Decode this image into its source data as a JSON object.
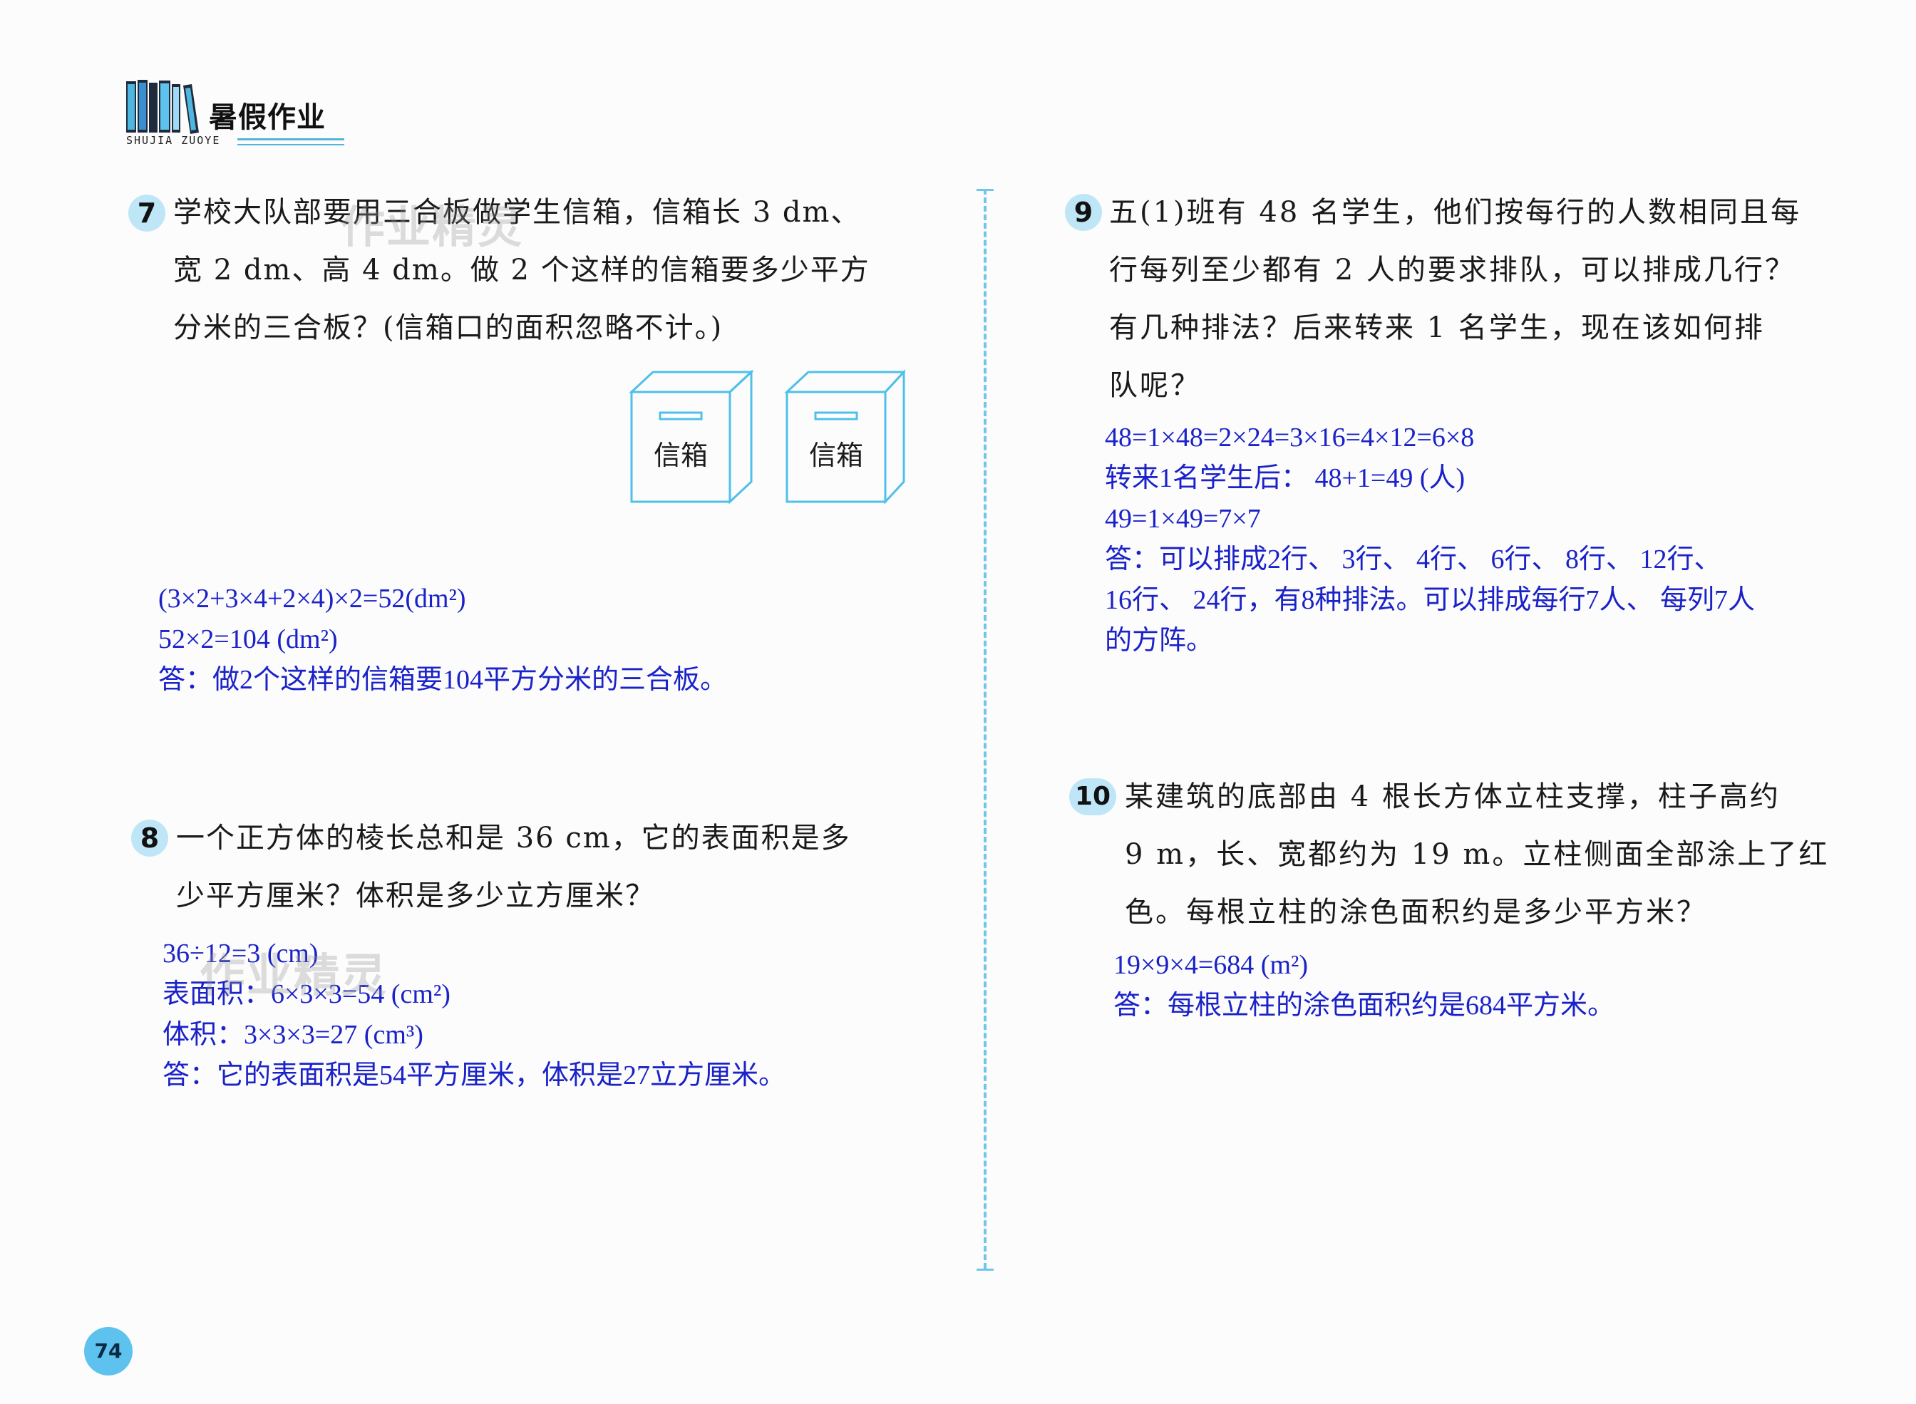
{
  "header": {
    "title": "暑假作业",
    "pinyin": "SHUJIA ZUOYE"
  },
  "questions": {
    "q7": {
      "number": "7",
      "lines": [
        "学校大队部要用三合板做学生信箱，信箱长 3 dm、",
        "宽 2 dm、高 4 dm。做 2 个这样的信箱要多少平方",
        "分米的三合板？(信箱口的面积忽略不计。)"
      ],
      "box_label": "信箱",
      "answer": [
        "(3×2+3×4+2×4)×2=52(dm²)",
        "52×2=104 (dm²)",
        "答：做2个这样的信箱要104平方分米的三合板。"
      ]
    },
    "q8": {
      "number": "8",
      "lines": [
        "一个正方体的棱长总和是 36 cm，它的表面积是多",
        "少平方厘米？体积是多少立方厘米？"
      ],
      "answer": [
        "36÷12=3 (cm)",
        "表面积：6×3×3=54 (cm²)",
        "体积：3×3×3=27 (cm³)",
        "答：它的表面积是54平方厘米，体积是27立方厘米。"
      ]
    },
    "q9": {
      "number": "9",
      "lines": [
        "五(1)班有 48 名学生，他们按每行的人数相同且每",
        "行每列至少都有 2 人的要求排队，可以排成几行？",
        "有几种排法？后来转来 1 名学生，现在该如何排",
        "队呢？"
      ],
      "answer": [
        "48=1×48=2×24=3×16=4×12=6×8",
        "转来1名学生后： 48+1=49 (人)",
        "49=1×49=7×7",
        "答：可以排成2行、 3行、 4行、 6行、 8行、 12行、",
        "16行、 24行，有8种排法。可以排成每行7人、 每列7人",
        "的方阵。"
      ]
    },
    "q10": {
      "number": "10",
      "lines": [
        "某建筑的底部由 4 根长方体立柱支撑，柱子高约",
        "9 m，长、宽都约为 19 m。立柱侧面全部涂上了红",
        "色。每根立柱的涂色面积约是多少平方米？"
      ],
      "answer": [
        "19×9×4=684 (m²)",
        "答：每根立柱的涂色面积约是684平方米。"
      ]
    }
  },
  "watermarks": {
    "top": "作业精灵",
    "bottom": "作业精灵"
  },
  "page_number": "74",
  "colors": {
    "accent": "#5ec2ee",
    "answer": "#1a22c8",
    "box_stroke": "#4fc0ea"
  }
}
